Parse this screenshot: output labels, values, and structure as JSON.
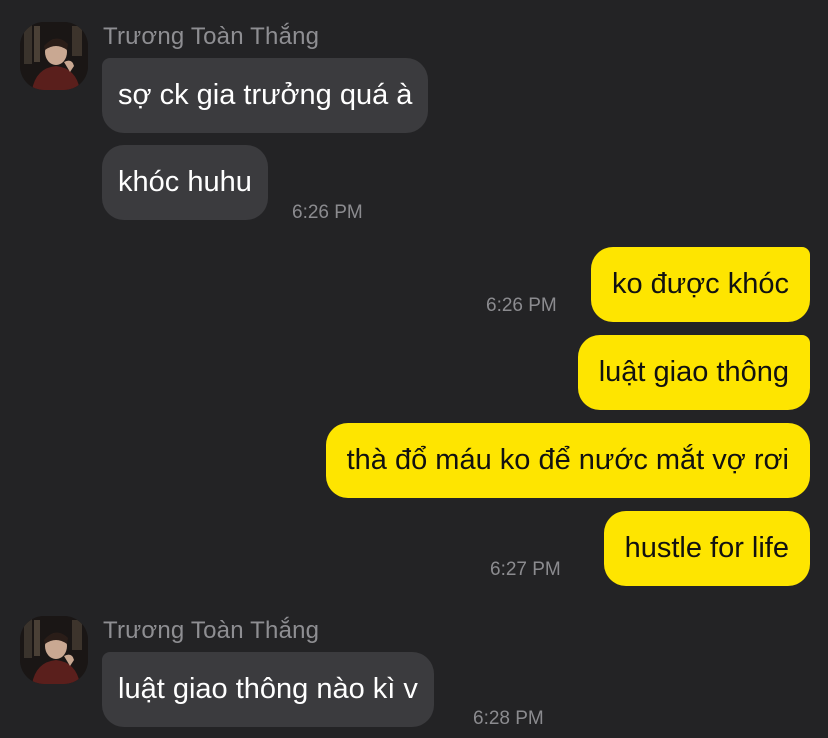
{
  "conversation": {
    "groups": [
      {
        "sender": "Trương Toàn Thắng",
        "messages": [
          "sợ ck gia trưởng quá à",
          "khóc huhu"
        ],
        "time": "6:26 PM"
      },
      {
        "sender": "me",
        "messages": [
          "ko được khóc"
        ],
        "time": "6:26 PM"
      },
      {
        "sender": "me",
        "messages": [
          "luật giao thông",
          "thà đổ máu ko để nước mắt vợ rơi",
          "hustle for life"
        ],
        "time": "6:27 PM"
      },
      {
        "sender": "Trương Toàn Thắng",
        "messages": [
          "luật giao thông nào kì v"
        ],
        "time": "6:28 PM"
      }
    ]
  },
  "colors": {
    "background": "#232325",
    "incoming_bubble": "#3b3b3e",
    "outgoing_bubble": "#fee500",
    "sender_name": "#8e8e92",
    "timestamp": "#8b8b8f"
  },
  "icons": {
    "avatar": "profile-photo-avatar"
  }
}
